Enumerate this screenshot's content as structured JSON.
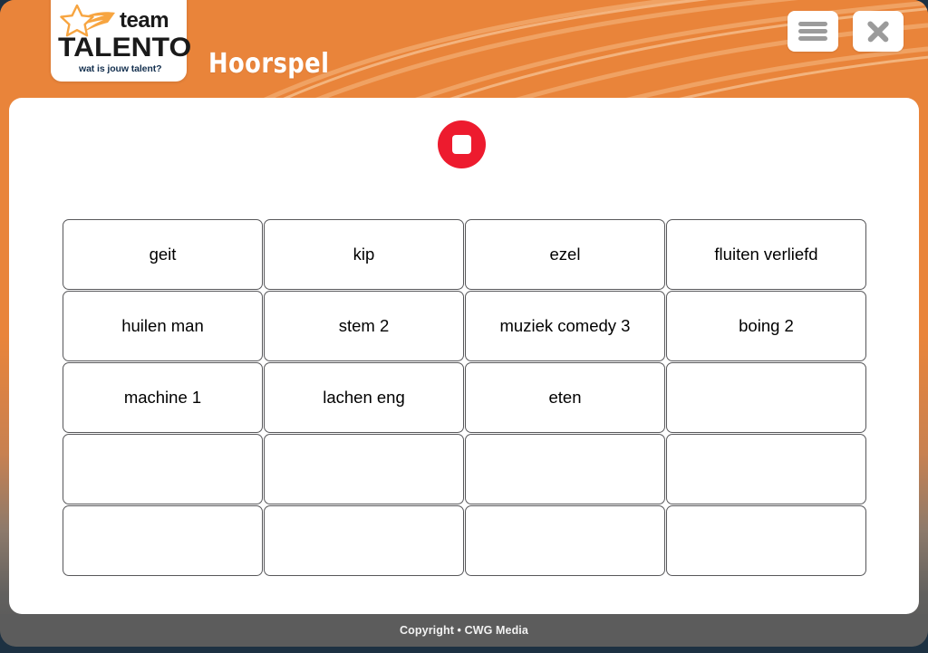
{
  "header": {
    "title": "Hoorspel",
    "logo": {
      "brand_top": "team",
      "brand_main": "TALENTO",
      "tagline": "wat is jouw talent?",
      "star_icon": "shooting-star-icon"
    },
    "buttons": {
      "menu_icon": "hamburger-menu-icon",
      "menu_label": "Menu",
      "close_icon": "close-x-icon",
      "close_label": "Sluiten"
    },
    "background_color": "#e9843a"
  },
  "main": {
    "transport": {
      "stop_icon": "stop-square-icon",
      "stop_label": "Stop",
      "stop_color": "#ed1b2e"
    },
    "grid": {
      "columns": 4,
      "rows": 5,
      "cells": [
        "geit",
        "kip",
        "ezel",
        "fluiten verliefd",
        "huilen man",
        "stem 2",
        "muziek comedy 3",
        "boing 2",
        "machine 1",
        "lachen eng",
        "eten",
        "",
        "",
        "",
        "",
        "",
        "",
        "",
        "",
        ""
      ]
    }
  },
  "footer": {
    "copyright": "Copyright • CWG Media",
    "background_color": "#5c5c5c"
  }
}
